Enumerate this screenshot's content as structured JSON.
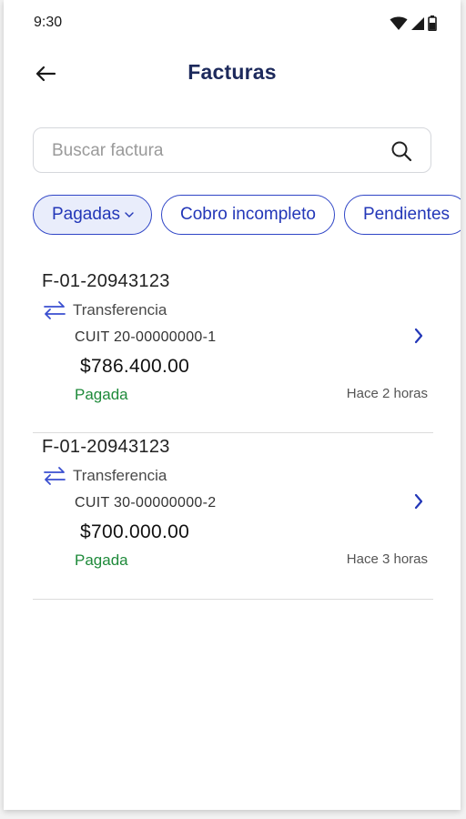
{
  "status_bar": {
    "time": "9:30",
    "icons": [
      "wifi-icon",
      "signal-icon",
      "battery-icon"
    ]
  },
  "header": {
    "title": "Facturas",
    "back_icon": "arrow-left-icon"
  },
  "search": {
    "placeholder": "Buscar factura",
    "value": "",
    "icon": "search-icon"
  },
  "filters": [
    {
      "label": "Pagadas",
      "active": true
    },
    {
      "label": "Cobro incompleto",
      "active": false
    },
    {
      "label": "Pendientes",
      "active": false
    }
  ],
  "invoices": [
    {
      "number": "F-01-20943123",
      "method": "Transferencia",
      "cuit": "CUIT 20-00000000-1",
      "amount": "$786.400.00",
      "status": "Pagada",
      "time": "Hace 2 horas"
    },
    {
      "number": "F-01-20943123",
      "method": "Transferencia",
      "cuit": "CUIT 30-00000000-2",
      "amount": "$700.000.00",
      "status": "Pagada",
      "time": "Hace 3 horas"
    }
  ],
  "colors": {
    "title": "#1d2a5c",
    "accent": "#2337b8",
    "chip_active_bg": "#e9edfb",
    "status_paid": "#1e8a3a"
  }
}
